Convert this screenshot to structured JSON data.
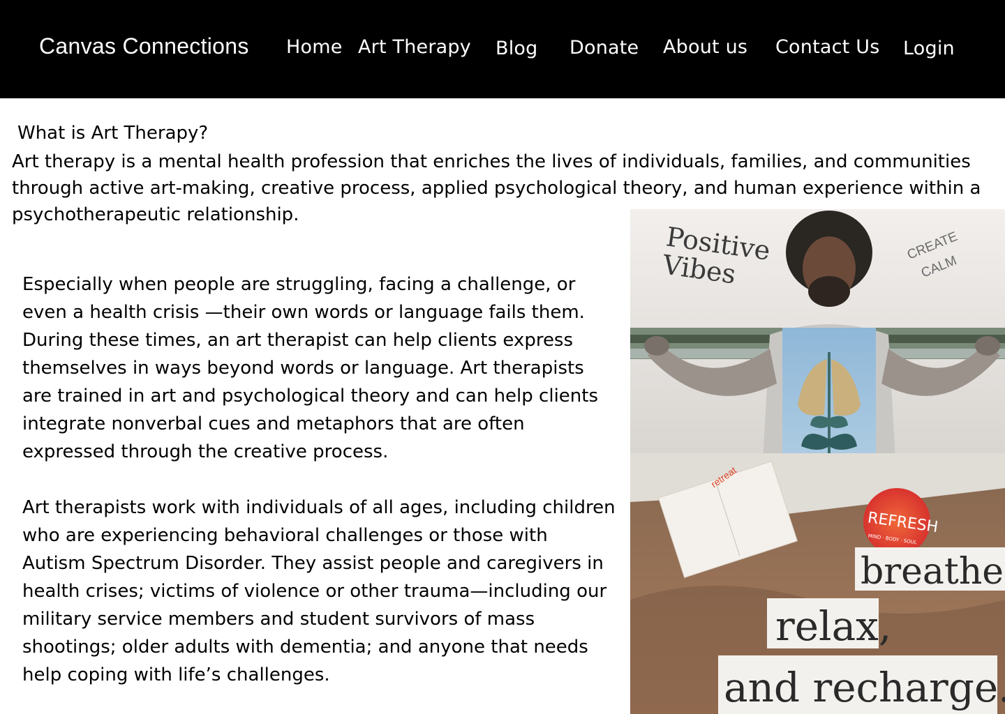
{
  "header": {
    "brand": "Canvas Connections",
    "nav": [
      {
        "label": "Home"
      },
      {
        "label": "Art Therapy"
      },
      {
        "label": "Blog"
      },
      {
        "label": "Donate"
      },
      {
        "label": "About us"
      },
      {
        "label": "Contact Us"
      },
      {
        "label": "Login"
      }
    ]
  },
  "main": {
    "heading": "What is Art Therapy?",
    "intro": "Art therapy is a mental health profession that enriches the lives of individuals, families, and communities through active art-making, creative process, applied psychological theory, and human experience within a psychotherapeutic relationship.",
    "paragraph1": "Especially when people are struggling, facing a challenge, or even a health crisis —their own words or language fails them. During these times, an art therapist can help clients express themselves in ways beyond words or language. Art therapists are trained in art and psychological theory and can help clients integrate nonverbal cues and metaphors that are often expressed through the creative process.",
    "paragraph2": "Art therapists work with individuals of all ages, including children who are experiencing behavioral challenges or those with Autism Spectrum Disorder. They assist people and caregivers in health crises; victims of violence or other trauma—including our military service members and student survivors of mass shootings; older adults with dementia; and anyone that needs help coping with life’s challenges."
  },
  "collage": {
    "positive_line1": "Positive",
    "positive_line2": "Vibes",
    "create_line1": "CREATE",
    "create_line2": "CALM",
    "retreat": "retreat",
    "refresh": "REFRESH",
    "refresh_sub": "MIND · BODY · SOUL",
    "breathe": "breathe,",
    "relax": "relax,",
    "recharge": "and recharge."
  },
  "colors": {
    "header_bg": "#000000",
    "header_text": "#ffffff",
    "body_text": "#000000",
    "page_bg": "#ffffff"
  }
}
